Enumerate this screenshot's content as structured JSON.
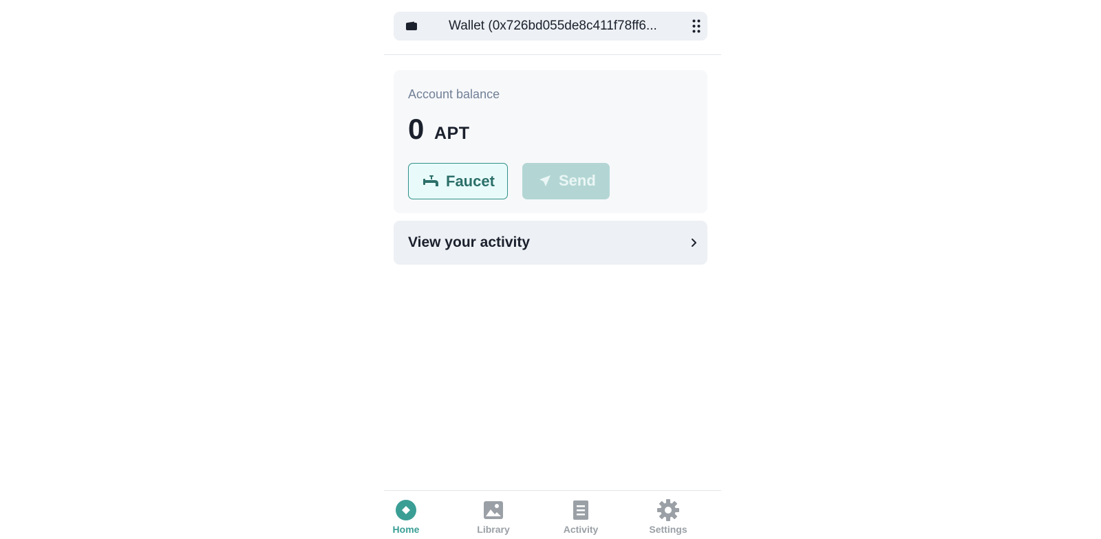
{
  "header": {
    "wallet_title": "Wallet (0x726bd055de8c411f78ff6...",
    "wallet_icon": "wallet-icon",
    "menu_icon": "grip-icon"
  },
  "balance": {
    "label": "Account balance",
    "amount": "0",
    "unit": "APT"
  },
  "actions": {
    "faucet_label": "Faucet",
    "faucet_icon": "faucet-icon",
    "send_label": "Send",
    "send_icon": "send-icon"
  },
  "activity_row": {
    "label": "View your activity",
    "icon": "chevron-right-icon"
  },
  "nav": {
    "items": [
      {
        "label": "Home",
        "icon": "home-icon",
        "active": true
      },
      {
        "label": "Library",
        "icon": "image-icon",
        "active": false
      },
      {
        "label": "Activity",
        "icon": "document-icon",
        "active": false
      },
      {
        "label": "Settings",
        "icon": "gear-icon",
        "active": false
      }
    ]
  },
  "colors": {
    "accent": "#3a9e95",
    "faucet_border": "#2f8f86",
    "send_disabled": "#b3d6d4",
    "nav_inactive": "#9aa0a6"
  }
}
